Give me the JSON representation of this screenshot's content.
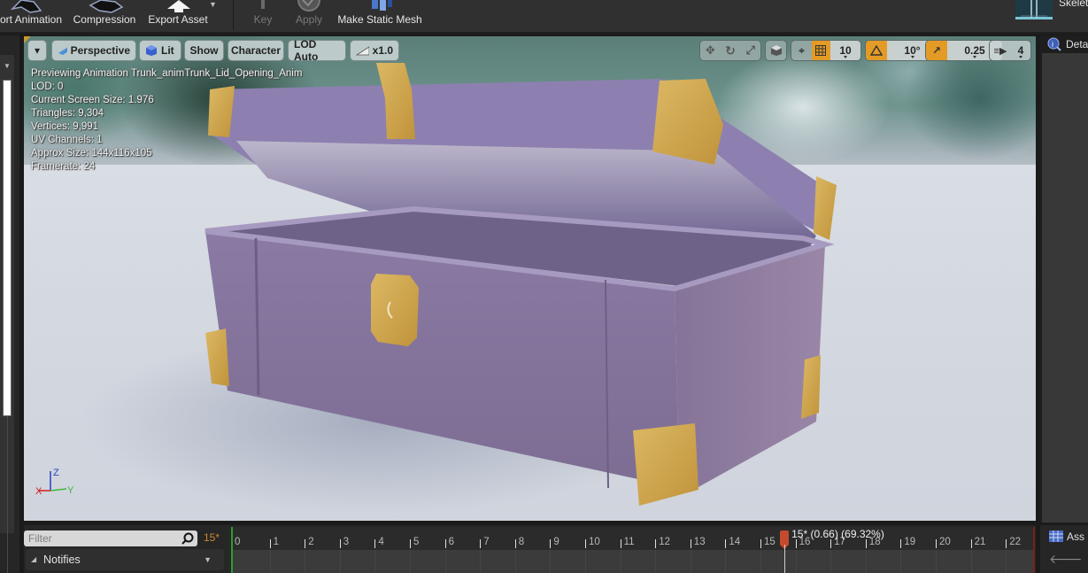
{
  "toolbar": {
    "items": [
      {
        "label": "ort Animation",
        "icon": "export-animation-icon",
        "enabled": true
      },
      {
        "label": "Compression",
        "icon": "compression-icon",
        "enabled": true
      },
      {
        "label": "Export Asset",
        "icon": "export-asset-icon",
        "enabled": true
      },
      {
        "label": "Key",
        "icon": "key-icon",
        "enabled": false
      },
      {
        "label": "Apply",
        "icon": "apply-icon",
        "enabled": false
      },
      {
        "label": "Make Static Mesh",
        "icon": "make-static-mesh-icon",
        "enabled": true
      }
    ],
    "skeleton_label": "Skelet"
  },
  "viewport": {
    "buttons": {
      "options": "▾",
      "perspective": "Perspective",
      "lit": "Lit",
      "show": "Show",
      "character": "Character",
      "lod": "LOD Auto",
      "speed": "x1.0"
    },
    "snap": {
      "grid_value": "10",
      "rotation_value": "10°",
      "scale_value": "0.25",
      "camera_speed": "4"
    },
    "info": {
      "line1": "Previewing Animation Trunk_animTrunk_Lid_Opening_Anim",
      "line2": "LOD: 0",
      "line3": "Current Screen Size: 1.976",
      "line4": "Triangles: 9,304",
      "line5": "Vertices: 9,991",
      "line6": "UV Channels: 1",
      "line7": "Approx Size: 144x116x105",
      "line8": "Framerate: 24"
    },
    "axes": {
      "z": "Z",
      "y": "Y",
      "x": "X"
    },
    "accent_orange": "#e39b26"
  },
  "right_panel": {
    "details_label": "Deta",
    "asset_label": "Ass"
  },
  "timeline": {
    "filter_placeholder": "Filter",
    "frame_count": "15*",
    "notifies_label": "Notifies",
    "ticks": [
      "0",
      "1",
      "2",
      "3",
      "4",
      "5",
      "6",
      "7",
      "8",
      "9",
      "10",
      "11",
      "12",
      "13",
      "14",
      "15",
      "16",
      "17",
      "18",
      "19",
      "20",
      "21",
      "22"
    ],
    "scrubber_label": "15* (0.66) (69.32%)",
    "scrubber_frame": 15.66,
    "total_frames": 23
  }
}
